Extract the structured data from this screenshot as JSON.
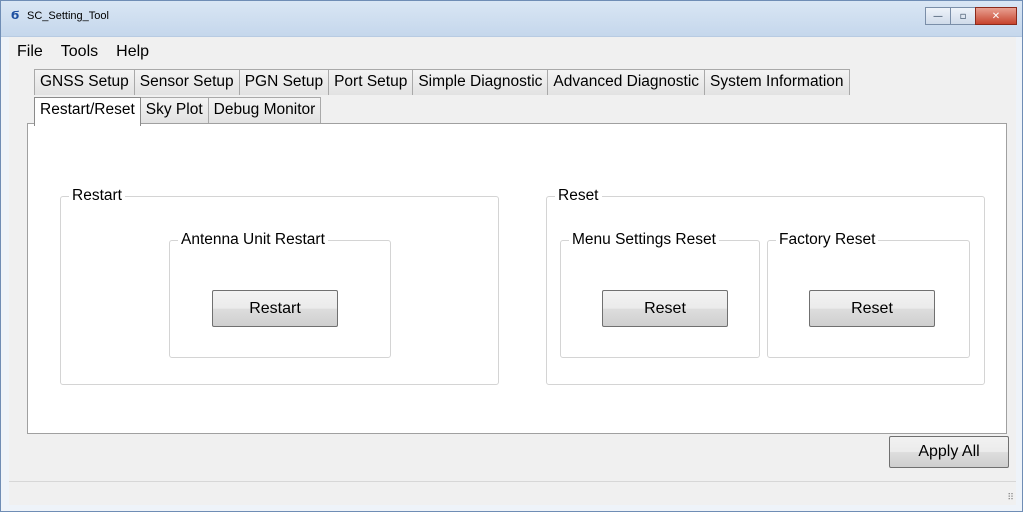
{
  "window": {
    "title": "SC_Setting_Tool",
    "app_icon": "Ϭ",
    "minimize": "—",
    "maximize": "▫",
    "close": "✕"
  },
  "menu": [
    "File",
    "Tools",
    "Help"
  ],
  "tabs_row1": [
    "GNSS Setup",
    "Sensor Setup",
    "PGN Setup",
    "Port Setup",
    "Simple Diagnostic",
    "Advanced Diagnostic",
    "System Information"
  ],
  "tabs_row2": [
    "Restart/Reset",
    "Sky Plot",
    "Debug Monitor"
  ],
  "active_tab": "Restart/Reset",
  "restart": {
    "group_label": "Restart",
    "antenna_group_label": "Antenna Unit Restart",
    "restart_button": "Restart"
  },
  "reset": {
    "group_label": "Reset",
    "menu_settings_label": "Menu Settings Reset",
    "menu_reset_button": "Reset",
    "factory_label": "Factory Reset",
    "factory_reset_button": "Reset"
  },
  "apply_all_button": "Apply All"
}
